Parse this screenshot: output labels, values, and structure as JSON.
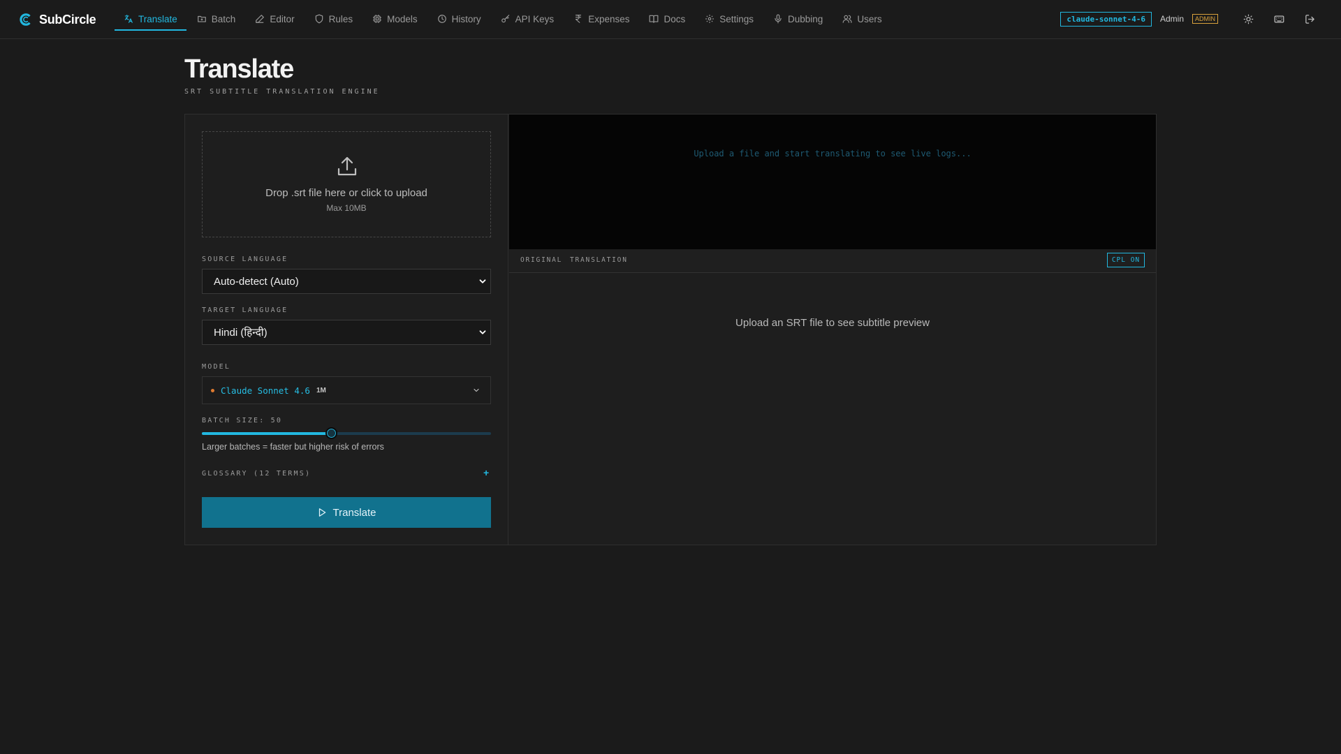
{
  "app": {
    "name": "SubCircle"
  },
  "nav": [
    {
      "label": "Translate",
      "icon": "languages-icon",
      "active": true
    },
    {
      "label": "Batch",
      "icon": "folder-icon"
    },
    {
      "label": "Editor",
      "icon": "pencil-icon"
    },
    {
      "label": "Rules",
      "icon": "shield-icon"
    },
    {
      "label": "Models",
      "icon": "cpu-icon"
    },
    {
      "label": "History",
      "icon": "clock-icon"
    },
    {
      "label": "API Keys",
      "icon": "key-icon"
    },
    {
      "label": "Expenses",
      "icon": "rupee-icon"
    },
    {
      "label": "Docs",
      "icon": "book-icon"
    },
    {
      "label": "Settings",
      "icon": "gear-icon"
    },
    {
      "label": "Dubbing",
      "icon": "mic-icon"
    },
    {
      "label": "Users",
      "icon": "users-icon"
    }
  ],
  "header": {
    "model_badge": "claude-sonnet-4-6",
    "user": "Admin",
    "role_badge": "ADMIN",
    "icons": [
      "sun-icon",
      "keyboard-icon",
      "logout-icon"
    ]
  },
  "page": {
    "title": "Translate",
    "subtitle": "SRT SUBTITLE TRANSLATION ENGINE"
  },
  "upload": {
    "prompt": "Drop .srt file here or click to upload",
    "limit": "Max 10MB"
  },
  "form": {
    "source_label": "SOURCE LANGUAGE",
    "source_value": "Auto-detect (Auto)",
    "target_label": "TARGET LANGUAGE",
    "target_value": "Hindi (हिन्दी)",
    "model_label": "MODEL",
    "model_value": "Claude Sonnet 4.6",
    "model_context": "1M",
    "batch_label": "BATCH SIZE: 50",
    "batch_fraction": 0.447,
    "batch_help": "Larger batches = faster but higher risk of errors",
    "glossary_label": "GLOSSARY (12 TERMS)",
    "glossary_add": "+",
    "submit_label": "Translate"
  },
  "logs": {
    "placeholder": "Upload a file and start translating to see live logs..."
  },
  "preview": {
    "tab_original": "ORIGINAL",
    "tab_translation": "TRANSLATION",
    "cpl_toggle": "CPL ON",
    "empty": "Upload an SRT file to see subtitle preview"
  },
  "colors": {
    "accent": "#22b8e0",
    "button": "#11728e",
    "admin": "#d9a13b",
    "background": "#1b1b1b"
  }
}
